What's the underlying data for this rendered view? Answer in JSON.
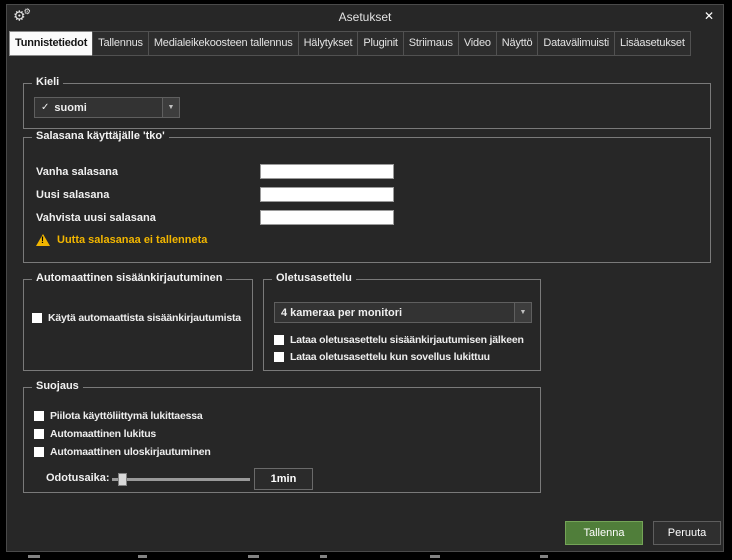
{
  "window": {
    "title": "Asetukset"
  },
  "icons": {
    "gear": "⚙",
    "close": "✕",
    "check": "✓",
    "dropdown_arrow": "▼"
  },
  "colors": {
    "save_button_green": "#507e3a",
    "warning_yellow": "#f2b600",
    "dialog_background": "#272727"
  },
  "tabs": [
    {
      "label": "Tunnistetiedot",
      "active": true
    },
    {
      "label": "Tallennus",
      "active": false
    },
    {
      "label": "Medialeikekoosteen tallennus",
      "active": false
    },
    {
      "label": "Hälytykset",
      "active": false
    },
    {
      "label": "Pluginit",
      "active": false
    },
    {
      "label": "Striimaus",
      "active": false
    },
    {
      "label": "Video",
      "active": false
    },
    {
      "label": "Näyttö",
      "active": false
    },
    {
      "label": "Datavälimuisti",
      "active": false
    },
    {
      "label": "Lisäasetukset",
      "active": false
    }
  ],
  "language_group": {
    "title": "Kieli",
    "selected": "suomi"
  },
  "password_group": {
    "title": "Salasana käyttäjälle 'tko'",
    "old_label": "Vanha salasana",
    "new_label": "Uusi salasana",
    "confirm_label": "Vahvista uusi salasana",
    "warning": "Uutta salasanaa ei tallenneta"
  },
  "autologin_group": {
    "title": "Automaattinen sisäänkirjautuminen",
    "checkbox": "Käytä automaattista sisäänkirjautumista"
  },
  "layout_group": {
    "title": "Oletusasettelu",
    "selected": "4 kameraa per monitori",
    "option1": "Lataa oletusasettelu sisäänkirjautumisen jälkeen",
    "option2": "Lataa oletusasettelu kun sovellus lukittuu"
  },
  "protection_group": {
    "title": "Suojaus",
    "option1": "Piilota käyttöliittymä lukittaessa",
    "option2": "Automaattinen lukitus",
    "option3": "Automaattinen uloskirjautuminen",
    "wait_label": "Odotusaika:",
    "wait_value": "1min"
  },
  "footer": {
    "save": "Tallenna",
    "cancel": "Peruuta"
  }
}
